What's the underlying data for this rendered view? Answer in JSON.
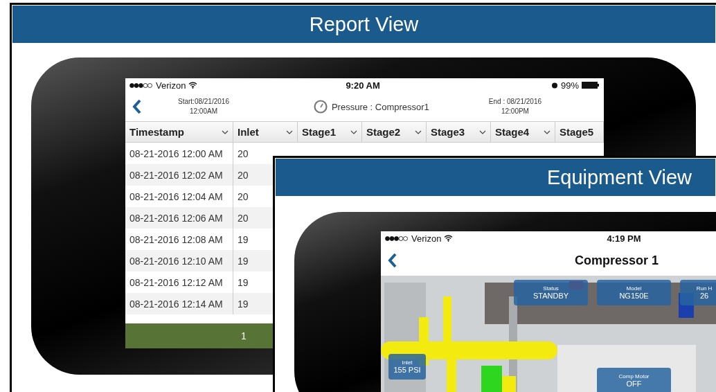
{
  "report_view": {
    "title": "Report View",
    "status_bar": {
      "carrier": "Verizon",
      "time": "9:20 AM",
      "battery": "99%"
    },
    "header": {
      "start_date": "Start:08/21/2016",
      "start_time": "12:00AM",
      "title": "Pressure : Compressor1",
      "end_date": "End : 08/21/2016",
      "end_time": "12:00PM"
    },
    "table": {
      "columns": [
        {
          "label": "Timestamp",
          "has_menu": true
        },
        {
          "label": "Inlet",
          "has_menu": true
        },
        {
          "label": "Stage1",
          "has_menu": true
        },
        {
          "label": "Stage2",
          "has_menu": true
        },
        {
          "label": "Stage3",
          "has_menu": true
        },
        {
          "label": "Stage4",
          "has_menu": true
        },
        {
          "label": "Stage5",
          "has_menu": false
        }
      ],
      "rows": [
        [
          "08-21-2016 12:00 AM",
          "20"
        ],
        [
          "08-21-2016 12:02 AM",
          "20"
        ],
        [
          "08-21-2016 12:04 AM",
          "20"
        ],
        [
          "08-21-2016 12:06 AM",
          "20"
        ],
        [
          "08-21-2016 12:08 AM",
          "19"
        ],
        [
          "08-21-2016 12:10 AM",
          "19"
        ],
        [
          "08-21-2016 12:12 AM",
          "19"
        ],
        [
          "08-21-2016 12:14 AM",
          "19"
        ]
      ]
    },
    "pager": {
      "page": "1"
    }
  },
  "equipment_view": {
    "title": "Equipment View",
    "status_bar": {
      "carrier": "Verizon",
      "time": "4:19 PM"
    },
    "header": {
      "title": "Compressor 1"
    },
    "tiles": [
      {
        "label": "Status",
        "value": "STANDBY"
      },
      {
        "label": "Model",
        "value": "NG150E"
      },
      {
        "label": "Run H",
        "value": "26"
      },
      {
        "label": "Inlet",
        "value": "155 PSI"
      },
      {
        "label": "Comp Motor",
        "value": "OFF"
      }
    ]
  }
}
